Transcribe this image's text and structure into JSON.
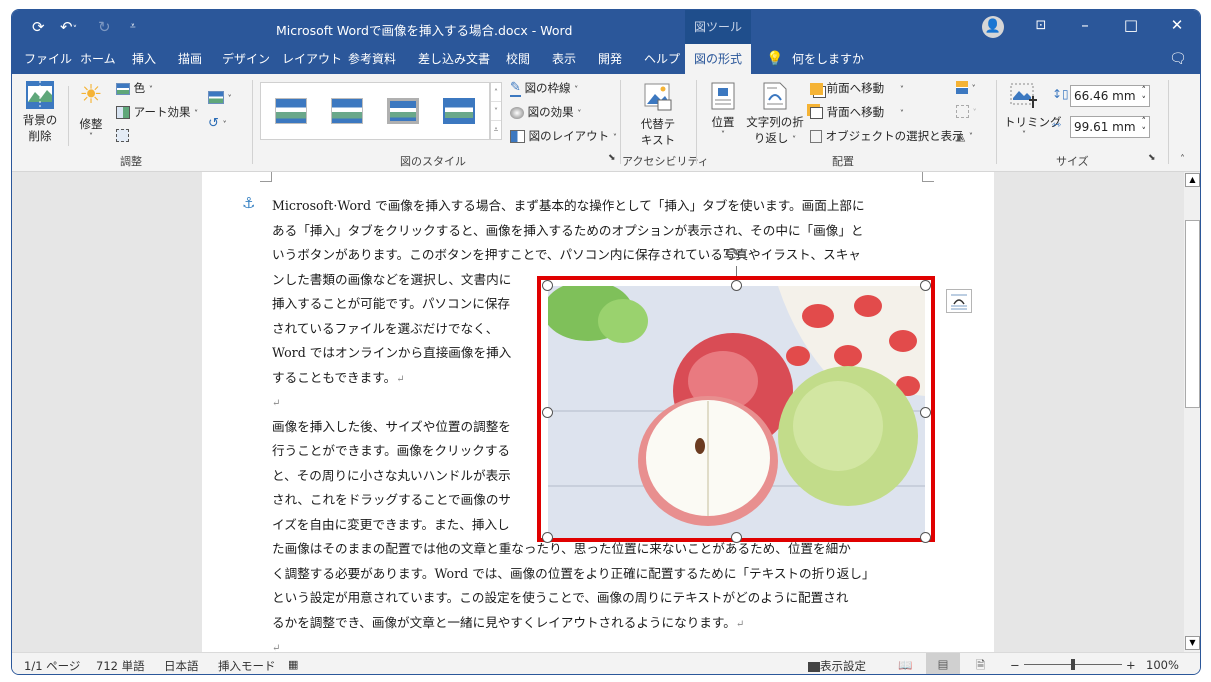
{
  "titlebar": {
    "title": "Microsoft Wordで画像を挿入する場合.docx  -  Word",
    "context_tab": "図ツール",
    "qat": {
      "save_icon": "autosave-icon",
      "undo_icon": "undo-icon",
      "redo_icon": "redo-icon",
      "customize_icon": "customize-qat-icon"
    },
    "controls": {
      "ribbon_display": "⊡",
      "minimize": "–",
      "maximize": "□",
      "close": "✕"
    }
  },
  "tabs": [
    {
      "label": "ファイル"
    },
    {
      "label": "ホーム"
    },
    {
      "label": "挿入"
    },
    {
      "label": "描画"
    },
    {
      "label": "デザイン"
    },
    {
      "label": "レイアウト"
    },
    {
      "label": "参考資料"
    },
    {
      "label": "差し込み文書"
    },
    {
      "label": "校閲"
    },
    {
      "label": "表示"
    },
    {
      "label": "開発"
    },
    {
      "label": "ヘルプ"
    },
    {
      "label": "図の形式",
      "active": true
    }
  ],
  "tell_me": "何をしますか",
  "ribbon": {
    "adjust": {
      "label": "調整",
      "remove_bg": "背景の\n削除",
      "remove_bg_1": "背景の",
      "remove_bg_2": "削除",
      "corrections": "修整",
      "color": "色",
      "artistic": "アート効果"
    },
    "styles": {
      "label": "図のスタイル",
      "border": "図の枠線",
      "effects": "図の効果",
      "layout": "図のレイアウト"
    },
    "accessibility": {
      "label": "アクセシビリティ",
      "alt_text_1": "代替テ",
      "alt_text_2": "キスト"
    },
    "arrange": {
      "label": "配置",
      "position": "位置",
      "wrap_1": "文字列の折",
      "wrap_2": "り返し",
      "bring_forward": "前面へ移動",
      "send_backward": "背面へ移動",
      "selection_pane": "オブジェクトの選択と表示"
    },
    "size": {
      "label": "サイズ",
      "crop": "トリミング",
      "height": "66.46 mm",
      "width": "99.61 mm"
    }
  },
  "document": {
    "para1": [
      "Microsoft·Word で画像を挿入する場合、まず基本的な操作として「挿入」タブを使います。画面上部に",
      "ある「挿入」タブをクリックすると、画像を挿入するためのオプションが表示され、その中に「画像」と",
      "いうボタンがあります。このボタンを押すことで、パソコン内に保存されている写真やイラスト、スキャ",
      "ンした書類の画像などを選択し、文書内に",
      "挿入することが可能です。パソコンに保存",
      "されているファイルを選ぶだけでなく、",
      "Word ではオンラインから直接画像を挿入",
      "することもできます。"
    ],
    "para2": [
      "画像を挿入した後、サイズや位置の調整を",
      "行うことができます。画像をクリックする",
      "と、その周りに小さな丸いハンドルが表示",
      "され、これをドラッグすることで画像のサ",
      "イズを自由に変更できます。また、挿入し",
      "た画像はそのままの配置では他の文章と重なったり、思った位置に来ないことがあるため、位置を細か",
      "く調整する必要があります。Word では、画像の位置をより正確に配置するために「テキストの折り返し」",
      "という設定が用意されています。この設定を使うことで、画像の周りにテキストがどのように配置され",
      "るかを調整でき、画像が文章と一緒に見やすくレイアウトされるようになります。"
    ],
    "return_mark": "↵",
    "image_description": "Apples on a white wooden table: a red apple, a halved apple and a green apple"
  },
  "status": {
    "page": "1/1 ページ",
    "words": "712 単語",
    "language": "日本語",
    "mode": "挿入モード",
    "display_settings": "表示設定",
    "zoom": "100%",
    "zoom_minus": "−",
    "zoom_plus": "+",
    "zoom_level": 0.5
  }
}
